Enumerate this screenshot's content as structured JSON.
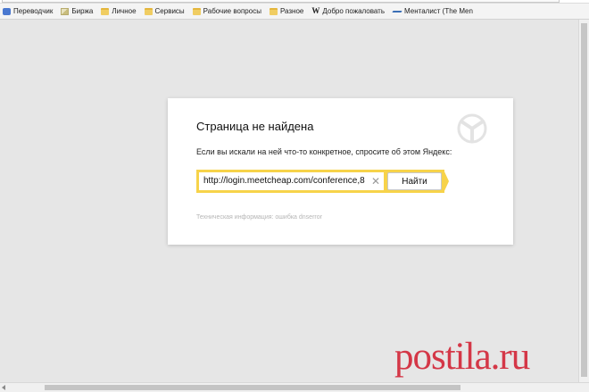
{
  "bookmarks": [
    {
      "label": "Переводчик",
      "icon": "translate-icon"
    },
    {
      "label": "Биржа",
      "icon": "stock-icon"
    },
    {
      "label": "Личное",
      "icon": "folder-icon"
    },
    {
      "label": "Сервисы",
      "icon": "folder-icon"
    },
    {
      "label": "Рабочие вопросы",
      "icon": "folder-icon"
    },
    {
      "label": "Разное",
      "icon": "folder-icon"
    },
    {
      "label": "Добро пожаловать",
      "icon": "wikipedia-icon",
      "icon_glyph": "W"
    },
    {
      "label": "Менталист (The Men",
      "icon": "mentalist-icon"
    }
  ],
  "error_card": {
    "title": "Страница не найдена",
    "description": "Если вы искали на ней что-то конкретное, спросите об этом Яндекс:",
    "search_value": "http://login.meetcheap.com/conference,8",
    "clear_glyph": "✕",
    "search_button": "Найти",
    "tech_info": "Техническая информация: ошибка dnserror"
  },
  "watermark": "postila.ru",
  "colors": {
    "accent": "#f7d34a",
    "watermark": "#d43747",
    "background": "#e6e6e6"
  }
}
